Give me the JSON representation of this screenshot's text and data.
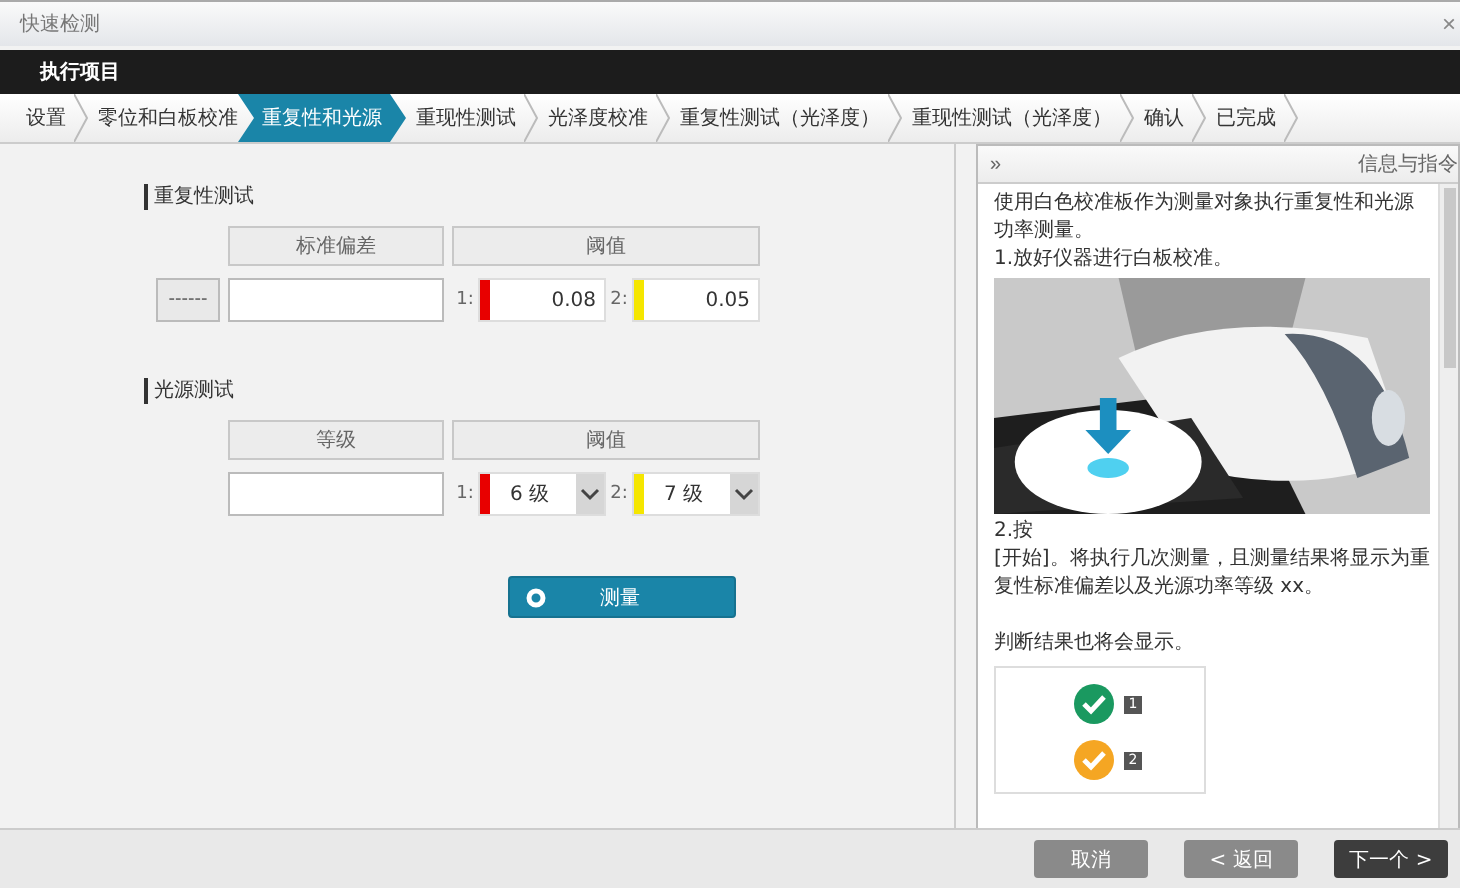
{
  "window": {
    "title": "快速检测",
    "close": "×"
  },
  "header": {
    "title": "执行项目"
  },
  "steps": [
    {
      "label": "设置",
      "selected": false
    },
    {
      "label": "零位和白板校准",
      "selected": false
    },
    {
      "label": "重复性和光源",
      "selected": true
    },
    {
      "label": "重现性测试",
      "selected": false
    },
    {
      "label": "光泽度校准",
      "selected": false
    },
    {
      "label": "重复性测试（光泽度）",
      "selected": false
    },
    {
      "label": "重现性测试（光泽度）",
      "selected": false
    },
    {
      "label": "确认",
      "selected": false
    },
    {
      "label": "已完成",
      "selected": false
    }
  ],
  "repeatability": {
    "title": "重复性测试",
    "columns": [
      "标准偏差",
      "阈值"
    ],
    "dash_button": "------",
    "thresholds": [
      {
        "index": "1:",
        "value": "0.08",
        "color": "#e80000"
      },
      {
        "index": "2:",
        "value": "0.05",
        "color": "#f5e600"
      }
    ]
  },
  "light_source": {
    "title": "光源测试",
    "columns": [
      "等级",
      "阈值"
    ],
    "thresholds": [
      {
        "index": "1:",
        "value": "6 级",
        "color": "#e80000"
      },
      {
        "index": "2:",
        "value": "7 级",
        "color": "#f5e600"
      }
    ]
  },
  "measure_button": "测量",
  "guide": {
    "collapse": "»",
    "title": "信息与指令",
    "intro": "使用白色校准板作为测量对象执行重复性和光源功率测量。",
    "step1": "1.放好仪器进行白板校准。",
    "step2": "2.按",
    "step2_detail": "[开始]。将执行几次测量，且测量结果将显示为重复性标准偏差以及光源功率等级 xx。",
    "results_note": "判断结果也将会显示。",
    "results": [
      {
        "color": "#1a9960",
        "badge": "1"
      },
      {
        "color": "#f5a623",
        "badge": "2"
      }
    ]
  },
  "buttons": [
    {
      "label": "取消",
      "kind": "secondary"
    },
    {
      "label": "< 返回",
      "kind": "secondary"
    },
    {
      "label": "下一个 >",
      "kind": "primary"
    }
  ]
}
